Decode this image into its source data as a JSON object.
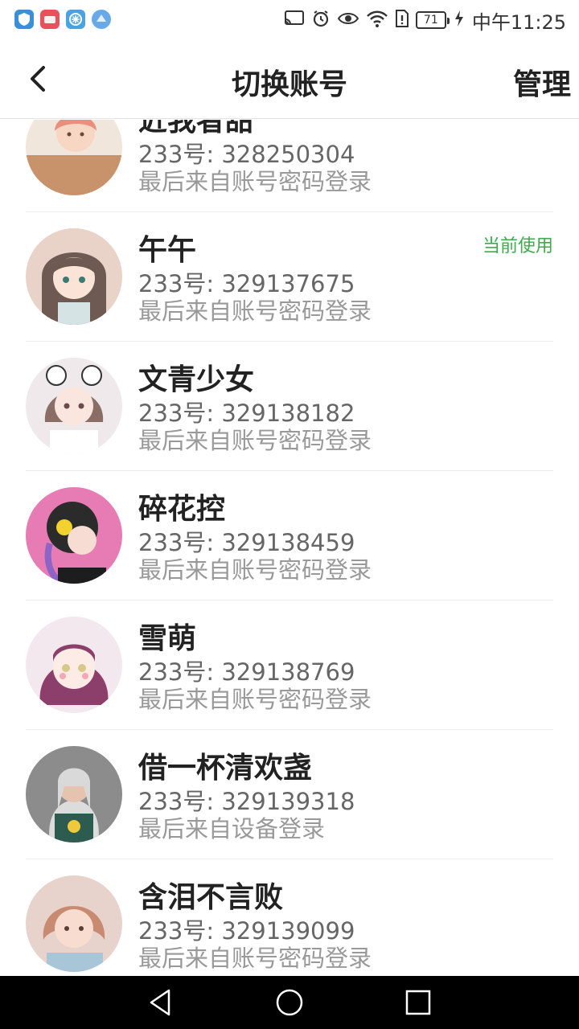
{
  "status_bar": {
    "time": "中午11:25",
    "battery": "71",
    "app_icons": [
      "shield-app-icon",
      "huawei-app-icon",
      "star-app-icon",
      "globe-app-icon"
    ],
    "system_icons": [
      "cast-icon",
      "alarm-icon",
      "eye-icon",
      "wifi-icon",
      "sim-icon",
      "battery-icon",
      "charging-icon"
    ]
  },
  "header": {
    "title": "切换账号",
    "manage_label": "管理",
    "back_icon": "chevron-left-icon"
  },
  "accounts": [
    {
      "name": "近我者甜",
      "uid": "233号: 328250304",
      "login": "最后来自账号密码登录",
      "current": ""
    },
    {
      "name": "午午",
      "uid": "233号: 329137675",
      "login": "最后来自账号密码登录",
      "current": "当前使用"
    },
    {
      "name": "文青少女",
      "uid": "233号: 329138182",
      "login": "最后来自账号密码登录",
      "current": ""
    },
    {
      "name": "碎花控",
      "uid": "233号: 329138459",
      "login": "最后来自账号密码登录",
      "current": ""
    },
    {
      "name": "雪萌",
      "uid": "233号: 329138769",
      "login": "最后来自账号密码登录",
      "current": ""
    },
    {
      "name": "借一杯清欢盏",
      "uid": "233号: 329139318",
      "login": "最后来自设备登录",
      "current": ""
    },
    {
      "name": "含泪不言败",
      "uid": "233号: 329139099",
      "login": "最后来自账号密码登录",
      "current": ""
    }
  ],
  "colors": {
    "accent_green": "#3dab4e",
    "text_primary": "#222222",
    "text_secondary": "#666666",
    "text_muted": "#999999",
    "divider": "#ececec"
  },
  "nav_bar": {
    "icons": [
      "back-triangle-icon",
      "home-circle-icon",
      "recents-square-icon"
    ]
  }
}
